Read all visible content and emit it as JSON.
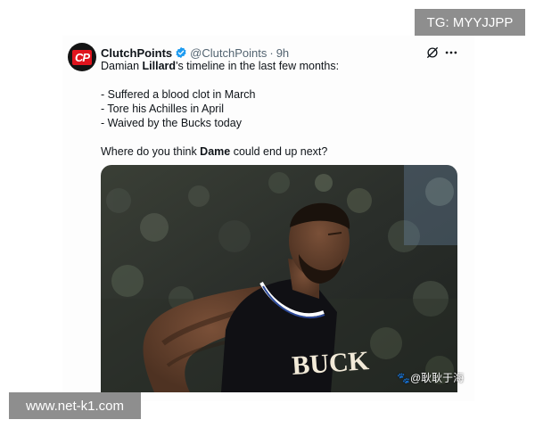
{
  "watermarks": {
    "top_right": "TG: MYYJJPP",
    "bottom_left": "www.net-k1.com",
    "image_credit": "🐾@耿耿于海"
  },
  "tweet": {
    "author": {
      "display_name": "ClutchPoints",
      "handle": "@ClutchPoints",
      "verified": true,
      "avatar_logo_text": "CP"
    },
    "separator": "·",
    "time_ago": "9h",
    "text": {
      "intro_pre": "Damian ",
      "intro_bold": "Lillard",
      "intro_post": "'s timeline in the last few months:",
      "bullets": [
        "- Suffered a blood clot in March",
        "- Tore his Achilles in April",
        "- Waived by the Bucks today"
      ],
      "question_pre": "Where do you think ",
      "question_bold": "Dame",
      "question_post": " could end up next?"
    },
    "media": {
      "jersey_text": "BUCK"
    }
  },
  "colors": {
    "verified_blue": "#1d9bf0",
    "text_primary": "#0f1419",
    "text_secondary": "#536471",
    "jersey": "#101014",
    "jersey_trim": "#ffffff",
    "skin": "#6b4632"
  }
}
